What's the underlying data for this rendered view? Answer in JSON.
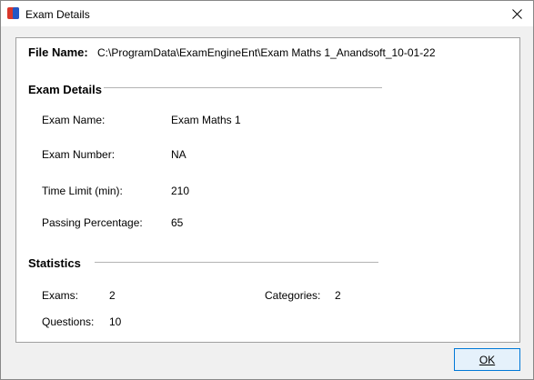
{
  "window": {
    "title": "Exam Details"
  },
  "file": {
    "label": "File Name:",
    "value": "C:\\ProgramData\\ExamEngineEnt\\Exam Maths 1_Anandsoft_10-01-22"
  },
  "exam_details": {
    "heading": "Exam Details",
    "rows": [
      {
        "label": "Exam Name:",
        "value": "Exam Maths 1"
      },
      {
        "label": "Exam Number:",
        "value": "NA"
      },
      {
        "label": "Time Limit (min):",
        "value": "210"
      },
      {
        "label": "Passing Percentage:",
        "value": "65"
      }
    ]
  },
  "statistics": {
    "heading": "Statistics",
    "exams_label": "Exams:",
    "exams_value": "2",
    "categories_label": "Categories:",
    "categories_value": "2",
    "questions_label": "Questions:",
    "questions_value": "10"
  },
  "buttons": {
    "ok": "OK"
  },
  "icons": {
    "app": "app-icon",
    "close": "close-icon"
  },
  "colors": {
    "accent": "#0078d7",
    "icon_red": "#d9372b",
    "icon_blue": "#2457c5"
  }
}
